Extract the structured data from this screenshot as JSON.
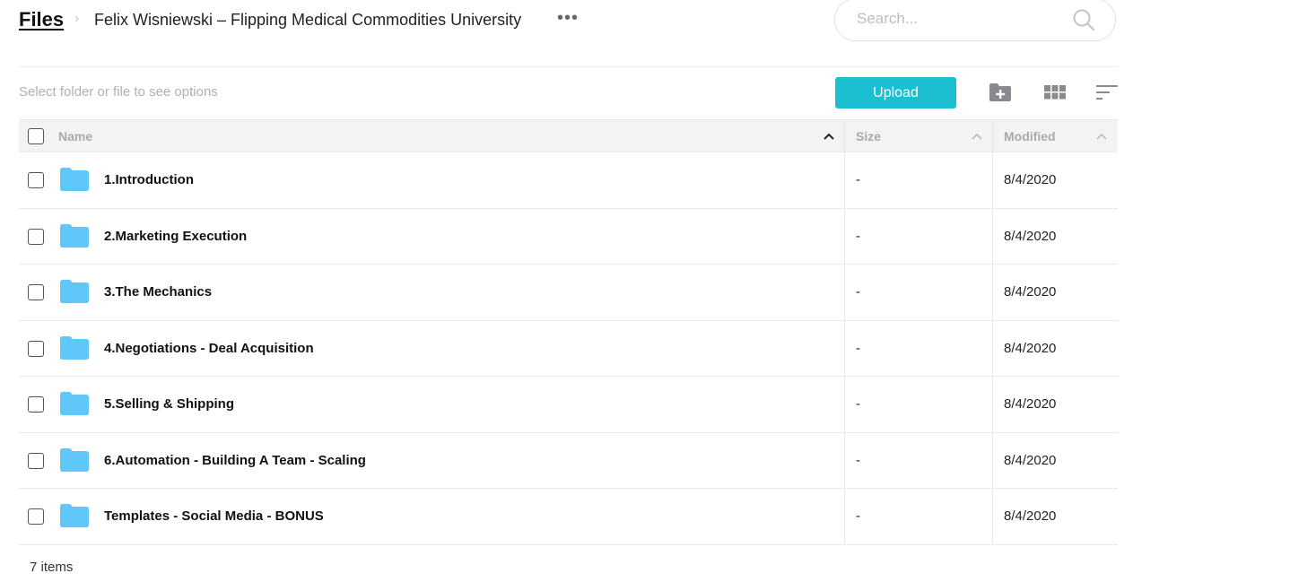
{
  "header": {
    "root_label": "Files",
    "separator": "›",
    "folder_title": "Felix Wisniewski – Flipping Medical Commodities University",
    "more_label": "•••",
    "search_placeholder": "Search..."
  },
  "toolbar": {
    "hint": "Select folder or file to see options",
    "upload_label": "Upload",
    "icons": [
      "new-folder-icon",
      "grid-view-icon",
      "sort-icon"
    ]
  },
  "colors": {
    "accent": "#1bbfd1",
    "folder": "#5fc8f8"
  },
  "table": {
    "columns": [
      {
        "label": "Name",
        "sort": "ascending-active"
      },
      {
        "label": "Size",
        "sort": "inactive"
      },
      {
        "label": "Modified",
        "sort": "inactive"
      }
    ],
    "rows": [
      {
        "name": "1.Introduction",
        "size": "-",
        "modified": "8/4/2020"
      },
      {
        "name": "2.Marketing Execution",
        "size": "-",
        "modified": "8/4/2020"
      },
      {
        "name": "3.The Mechanics",
        "size": "-",
        "modified": "8/4/2020"
      },
      {
        "name": "4.Negotiations - Deal Acquisition",
        "size": "-",
        "modified": "8/4/2020"
      },
      {
        "name": "5.Selling & Shipping",
        "size": "-",
        "modified": "8/4/2020"
      },
      {
        "name": "6.Automation - Building A Team - Scaling",
        "size": "-",
        "modified": "8/4/2020"
      },
      {
        "name": "Templates - Social Media - BONUS",
        "size": "-",
        "modified": "8/4/2020"
      }
    ]
  },
  "footer": {
    "count": "7 items"
  }
}
